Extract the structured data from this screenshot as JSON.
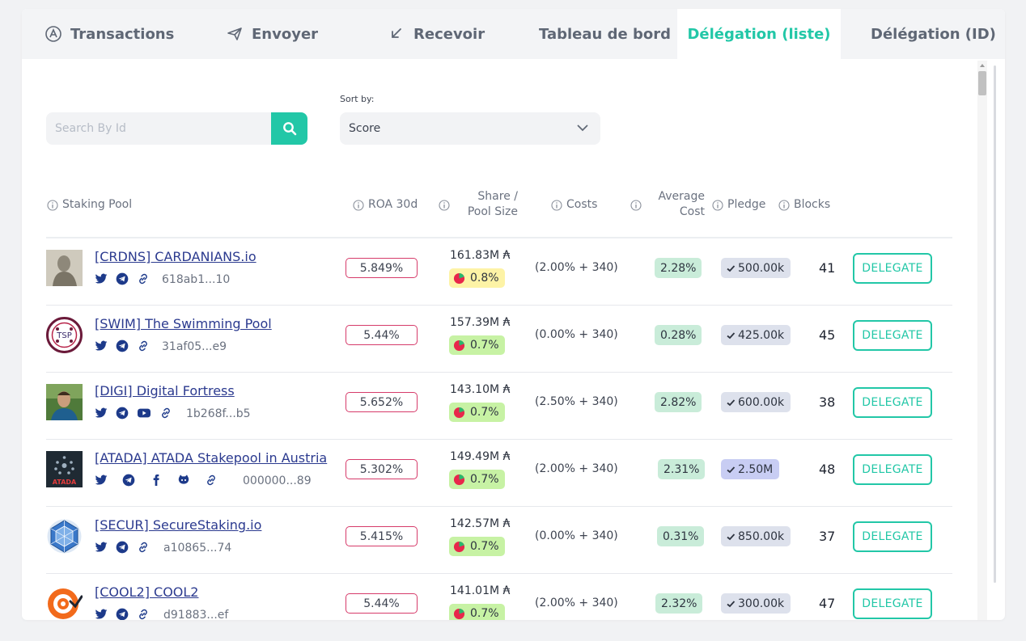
{
  "tabs": [
    {
      "label": "Transactions",
      "icon": "cardano-icon"
    },
    {
      "label": "Envoyer",
      "icon": "paper-plane-icon"
    },
    {
      "label": "Recevoir",
      "icon": "arrow-down-left-icon"
    },
    {
      "label": "Tableau de bord"
    },
    {
      "label": "Délégation (liste)",
      "active": true
    },
    {
      "label": "Délégation (ID)"
    }
  ],
  "search": {
    "placeholder": "Search By Id"
  },
  "sort": {
    "label": "Sort by:",
    "value": "Score"
  },
  "columns": {
    "pool": "Staking Pool",
    "roa": "ROA 30d",
    "share_line1": "Share /",
    "share_line2": "Pool Size",
    "costs": "Costs",
    "avg_line1": "Average",
    "avg_line2": "Cost",
    "pledge": "Pledge",
    "blocks": "Blocks"
  },
  "delegate_label": "DELEGATE",
  "colors": {
    "accent": "#22c7a7",
    "roa_border": "#d63b6a",
    "link": "#2b3a8f"
  },
  "pools": [
    {
      "name": "[CRDNS] CARDANIANS.io",
      "socials": [
        "twitter",
        "telegram",
        "link"
      ],
      "id": "618ab1...10",
      "roa": "5.849%",
      "size": "161.83M ₳",
      "share": "0.8%",
      "share_level": "high",
      "costs": "(2.00% + 340)",
      "avg": "2.28%",
      "pledge": "500.00k",
      "pledge_high": false,
      "blocks": "41"
    },
    {
      "name": "[SWIM] The Swimming Pool",
      "socials": [
        "twitter",
        "telegram",
        "link"
      ],
      "id": "31af05...e9",
      "roa": "5.44%",
      "size": "157.39M ₳",
      "share": "0.7%",
      "share_level": "normal",
      "costs": "(0.00% + 340)",
      "avg": "0.28%",
      "pledge": "425.00k",
      "pledge_high": false,
      "blocks": "45"
    },
    {
      "name": "[DIGI] Digital Fortress",
      "socials": [
        "twitter",
        "telegram",
        "youtube",
        "link"
      ],
      "id": "1b268f...b5",
      "roa": "5.652%",
      "size": "143.10M ₳",
      "share": "0.7%",
      "share_level": "normal",
      "costs": "(2.50% + 340)",
      "avg": "2.82%",
      "pledge": "600.00k",
      "pledge_high": false,
      "blocks": "38"
    },
    {
      "name": "[ATADA] ATADA Stakepool in Austria",
      "socials": [
        "twitter",
        "telegram",
        "facebook",
        "github",
        "link"
      ],
      "id": "000000...89",
      "roa": "5.302%",
      "size": "149.49M ₳",
      "share": "0.7%",
      "share_level": "normal",
      "costs": "(2.00% + 340)",
      "avg": "2.31%",
      "pledge": "2.50M",
      "pledge_high": true,
      "blocks": "48"
    },
    {
      "name": "[SECUR] SecureStaking.io",
      "socials": [
        "twitter",
        "telegram",
        "link"
      ],
      "id": "a10865...74",
      "roa": "5.415%",
      "size": "142.57M ₳",
      "share": "0.7%",
      "share_level": "normal",
      "costs": "(0.00% + 340)",
      "avg": "0.31%",
      "pledge": "850.00k",
      "pledge_high": false,
      "blocks": "37"
    },
    {
      "name": "[COOL2] COOL2",
      "socials": [
        "twitter",
        "telegram",
        "link"
      ],
      "id": "d91883...ef",
      "roa": "5.44%",
      "size": "141.01M ₳",
      "share": "0.7%",
      "share_level": "normal",
      "costs": "(2.00% + 340)",
      "avg": "2.32%",
      "pledge": "300.00k",
      "pledge_high": false,
      "blocks": "47"
    }
  ]
}
